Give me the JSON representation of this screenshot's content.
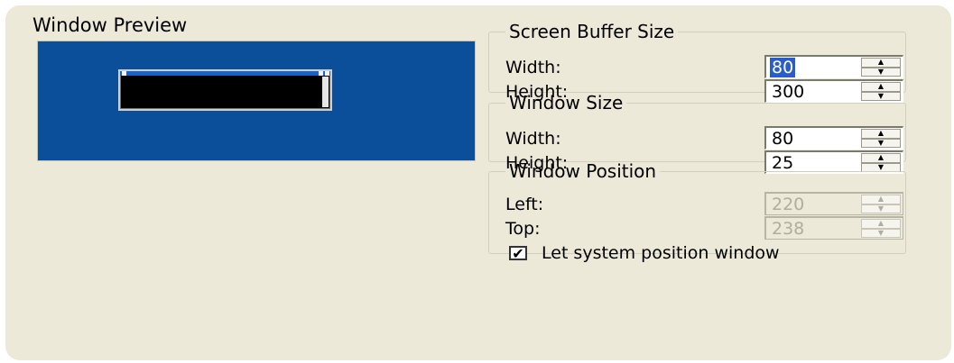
{
  "preview": {
    "label": "Window Preview"
  },
  "screen_buffer": {
    "legend": "Screen Buffer Size",
    "width_label": "Width:",
    "width_value": "80",
    "height_label": "Height:",
    "height_value": "300"
  },
  "window_size": {
    "legend": "Window Size",
    "width_label": "Width:",
    "width_value": "80",
    "height_label": "Height:",
    "height_value": "25"
  },
  "window_position": {
    "legend": "Window Position",
    "left_label": "Left:",
    "left_value": "220",
    "top_label": "Top:",
    "top_value": "238",
    "checkbox_label": "Let system position window",
    "checkbox_checked": true
  },
  "colors": {
    "panel_bg": "#ece9d8",
    "preview_bg": "#0b4f9a",
    "selection": "#2a5dc9"
  }
}
